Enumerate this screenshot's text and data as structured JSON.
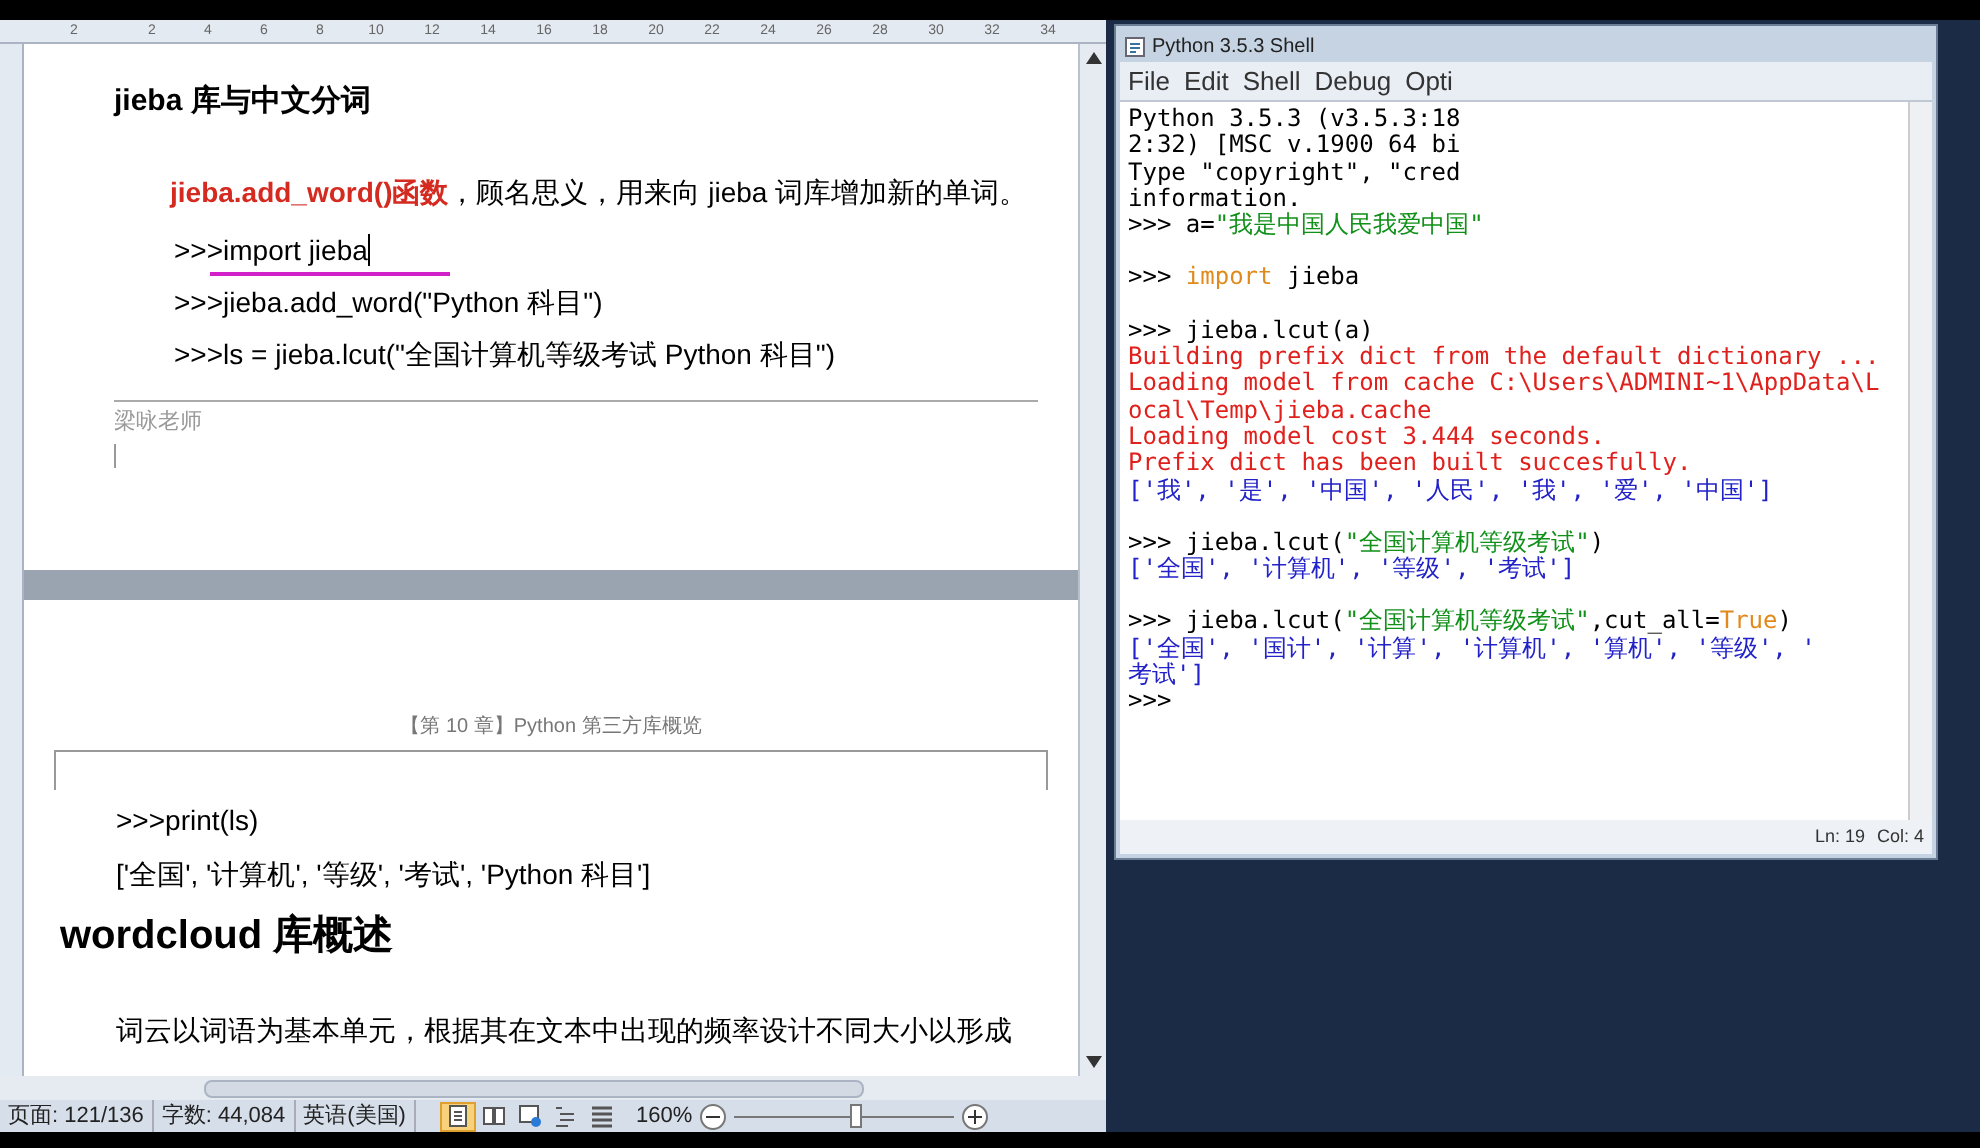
{
  "word": {
    "ruler_numbers": [
      "2",
      "2",
      "4",
      "6",
      "8",
      "10",
      "12",
      "14",
      "16",
      "18",
      "20",
      "22",
      "24",
      "26",
      "28",
      "30",
      "32",
      "34"
    ],
    "page1": {
      "heading": "jieba 库与中文分词",
      "paragraph": [
        {
          "text": "jieba.add_word()函数",
          "kind": "highlight"
        },
        {
          "text": "，顾名思义，用来向 jieba 词库增加新的单词。",
          "kind": "plain"
        }
      ],
      "code_lines": [
        ">>>import jieba",
        ">>>jieba.add_word(\"Python 科目\")",
        ">>>ls = jieba.lcut(\"全国计算机等级考试 Python 科目\")"
      ],
      "comment": "梁咏老师"
    },
    "page2": {
      "header": "【第 10 章】Python 第三方库概览",
      "code_lines": [
        ">>>print(ls)",
        "['全国', '计算机', '等级', '考试', 'Python 科目']"
      ],
      "heading": "wordcloud 库概述",
      "paragraph": "词云以词语为基本单元，根据其在文本中出现的频率设计不同大小以形成"
    },
    "status_bar": {
      "page": "页面: 121/136",
      "words": "字数: 44,084",
      "language": "英语(美国)",
      "views": [
        {
          "kind": "print",
          "selected": true
        },
        {
          "kind": "reading",
          "selected": false
        },
        {
          "kind": "web",
          "selected": false
        },
        {
          "kind": "outline",
          "selected": false
        },
        {
          "kind": "draft",
          "selected": false
        }
      ],
      "zoom": "160%",
      "zoom_slider": {
        "level": 0.55
      }
    }
  },
  "shell": {
    "title": "Python 3.5.3 Shell",
    "menu": [
      "File",
      "Edit",
      "Shell",
      "Debug",
      "Opti"
    ],
    "blocks": [
      {
        "lines": [
          [
            {
              "text": "Python 3.5.3 (v3.5.3:18",
              "kind": "plain"
            }
          ],
          [
            {
              "text": "2:32) [MSC v.1900 64 bi",
              "kind": "plain"
            }
          ],
          [
            {
              "text": "Type \"copyright\", \"cred",
              "kind": "plain"
            }
          ],
          [
            {
              "text": "information.",
              "kind": "plain"
            }
          ],
          [
            {
              "text": ">>> a=",
              "kind": "plain"
            },
            {
              "text": "\"我是中国人民我爱中国\"",
              "kind": "string"
            }
          ]
        ]
      },
      {
        "lines": [
          [
            {
              "text": ">>> ",
              "kind": "plain"
            },
            {
              "text": "import",
              "kind": "keyword"
            },
            {
              "text": " jieba",
              "kind": "plain"
            }
          ]
        ]
      },
      {
        "lines": [
          [
            {
              "text": ">>> jieba.lcut(a)",
              "kind": "plain"
            }
          ],
          [
            {
              "text": "Building prefix dict from the default dictionary ...",
              "kind": "error"
            }
          ],
          [
            {
              "text": "Loading model from cache C:\\Users\\ADMINI~1\\AppData\\L",
              "kind": "error"
            }
          ],
          [
            {
              "text": "ocal\\Temp\\jieba.cache",
              "kind": "error"
            }
          ],
          [
            {
              "text": "Loading model cost 3.444 seconds.",
              "kind": "error"
            }
          ],
          [
            {
              "text": "Prefix dict has been built succesfully.",
              "kind": "error"
            }
          ],
          [
            {
              "text": "['我', '是', '中国', '人民', '我', '爱', '中国']",
              "kind": "output"
            }
          ]
        ]
      },
      {
        "lines": [
          [
            {
              "text": ">>> jieba.lcut(",
              "kind": "plain"
            },
            {
              "text": "\"全国计算机等级考试\"",
              "kind": "string"
            },
            {
              "text": ")",
              "kind": "plain"
            }
          ],
          [
            {
              "text": "['全国', '计算机', '等级', '考试']",
              "kind": "output"
            }
          ]
        ]
      },
      {
        "lines": [
          [
            {
              "text": ">>> jieba.lcut(",
              "kind": "plain"
            },
            {
              "text": "\"全国计算机等级考试\"",
              "kind": "string"
            },
            {
              "text": ",cut_all=",
              "kind": "plain"
            },
            {
              "text": "True",
              "kind": "keyword"
            },
            {
              "text": ")",
              "kind": "plain"
            }
          ],
          [
            {
              "text": "['全国', '国计', '计算', '计算机', '算机', '等级', '",
              "kind": "output"
            }
          ],
          [
            {
              "text": "考试']",
              "kind": "output"
            }
          ],
          [
            {
              "text": ">>>",
              "kind": "plain"
            }
          ]
        ]
      }
    ],
    "status": [
      "Ln: 19",
      "Col: 4"
    ]
  }
}
